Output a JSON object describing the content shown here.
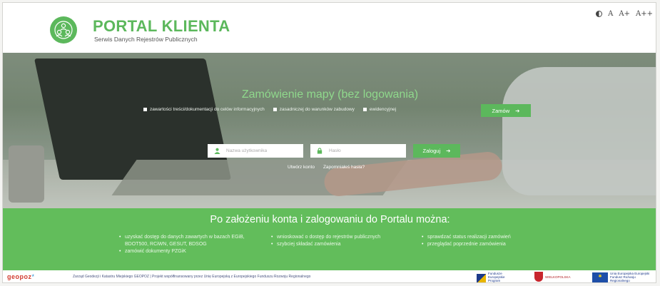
{
  "header": {
    "title": "PORTAL KLIENTA",
    "subtitle": "Serwis Danych Rejestrów Publicznych",
    "a11y": [
      "A",
      "A+",
      "A++"
    ],
    "logo_icon": "people-network-icon",
    "contrast_icon": "contrast-icon"
  },
  "hero": {
    "title": "Zamówienie mapy (bez logowania)",
    "checks": [
      "zawartości treści/dokumentacji do celów informacyjnych",
      "zasadniczej do warunków zabudowy",
      "ewidencyjnej"
    ],
    "order_button": "Zamów",
    "username_placeholder": "Nazwa użytkownika",
    "password_placeholder": "Hasło",
    "login_button": "Zaloguj",
    "link_register": "Utwórz konto",
    "link_forgot": "Zapomniałeś hasła?"
  },
  "info": {
    "title": "Po założeniu konta i zalogowaniu do Portalu można:",
    "col1": [
      "uzyskać dostęp do danych zawartych w bazach EGiB, BDOT500, RCiWN, GESUT, BDSOG",
      "zamówić dokumenty PZGiK"
    ],
    "col2": [
      "wnioskować o dostęp do rejestrów publicznych",
      "szybciej składać zamówienia"
    ],
    "col3": [
      "sprawdzać status realizacji zamówień",
      "przeglądać poprzednie zamówienia"
    ]
  },
  "footer": {
    "brand": "geopoz",
    "text": "Zarząd Geodezji i Katastru Miejskiego GEOPOZ | Projekt współfinansowany przez Unię Europejską z Europejskiego Funduszu Rozwoju Regionalnego",
    "eu_funds": "Fundusze Europejskie Program Regionalny",
    "region": "WIELKOPOLSKA",
    "eu": "Unia Europejska Europejski Fundusz Rozwoju Regionalnego"
  },
  "colors": {
    "accent": "#5cb85c",
    "band": "#62bd5b"
  }
}
